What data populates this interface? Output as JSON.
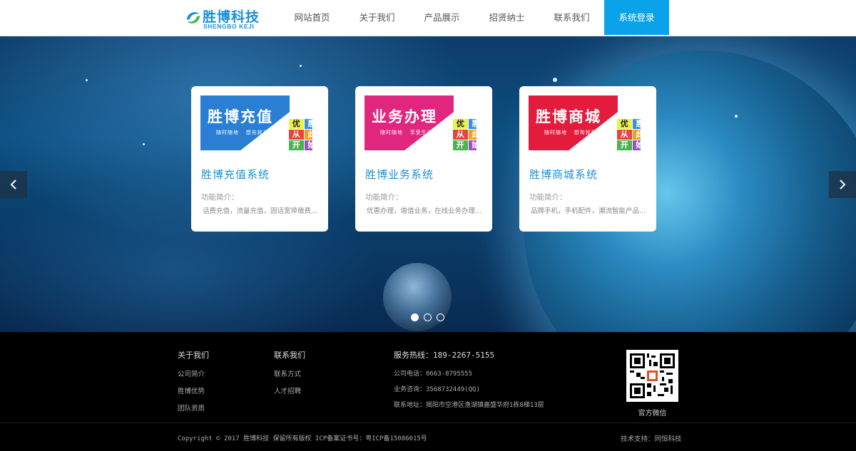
{
  "header": {
    "logo_cn": "胜博科技",
    "logo_en": "SHENGBO KEJI",
    "nav": [
      {
        "label": "网站首页"
      },
      {
        "label": "关于我们"
      },
      {
        "label": "产品展示"
      },
      {
        "label": "招贤纳士"
      },
      {
        "label": "联系我们"
      },
      {
        "label": "系统登录",
        "active": true
      }
    ]
  },
  "banner": {
    "cards": [
      {
        "image_title": "胜博充值",
        "image_tag1": "随时随地",
        "image_tag2": "想充就充",
        "title": "胜博充值系统",
        "sub": "功能简介：",
        "desc": "话费充值，流量充值，固话宽带缴费...",
        "color": "#2a7fd4"
      },
      {
        "image_title": "业务办理",
        "image_tag1": "随时随地",
        "image_tag2": "享受生活",
        "title": "胜博业务系统",
        "sub": "功能简介：",
        "desc": "优惠办理，增值业务，在线业务办理...",
        "color": "#e0267f"
      },
      {
        "image_title": "胜博商城",
        "image_tag1": "随时随地",
        "image_tag2": "想淘就淘",
        "title": "胜博商城系统",
        "sub": "功能简介：",
        "desc": "品牌手机，手机配件，潮流智能产品...",
        "color": "#e31b3d"
      }
    ],
    "grid_chars": [
      "优",
      "惠",
      "从",
      "此",
      "开",
      "始"
    ],
    "dots": 3,
    "active_dot": 0
  },
  "footer": {
    "col1": {
      "title": "关于我们",
      "links": [
        "公司简介",
        "胜博优势",
        "团队资质"
      ]
    },
    "col2": {
      "title": "联系我们",
      "links": [
        "联系方式",
        "人才招聘"
      ]
    },
    "col3": {
      "title": "服务热线：189-2267-5155",
      "lines": [
        "公司电话：0663-8795555",
        "业务咨询：3568732449(QQ)",
        "联系地址：揭阳市空港区渔湖镇嘉盛华府1栋8梯13层"
      ]
    },
    "qr_label": "官方微信",
    "copyright": "Copyright © 2017 胜博科技 保留所有版权 ICP备案证书号：粤ICP备15086015号",
    "tech": "技术支持：同恒科技"
  }
}
